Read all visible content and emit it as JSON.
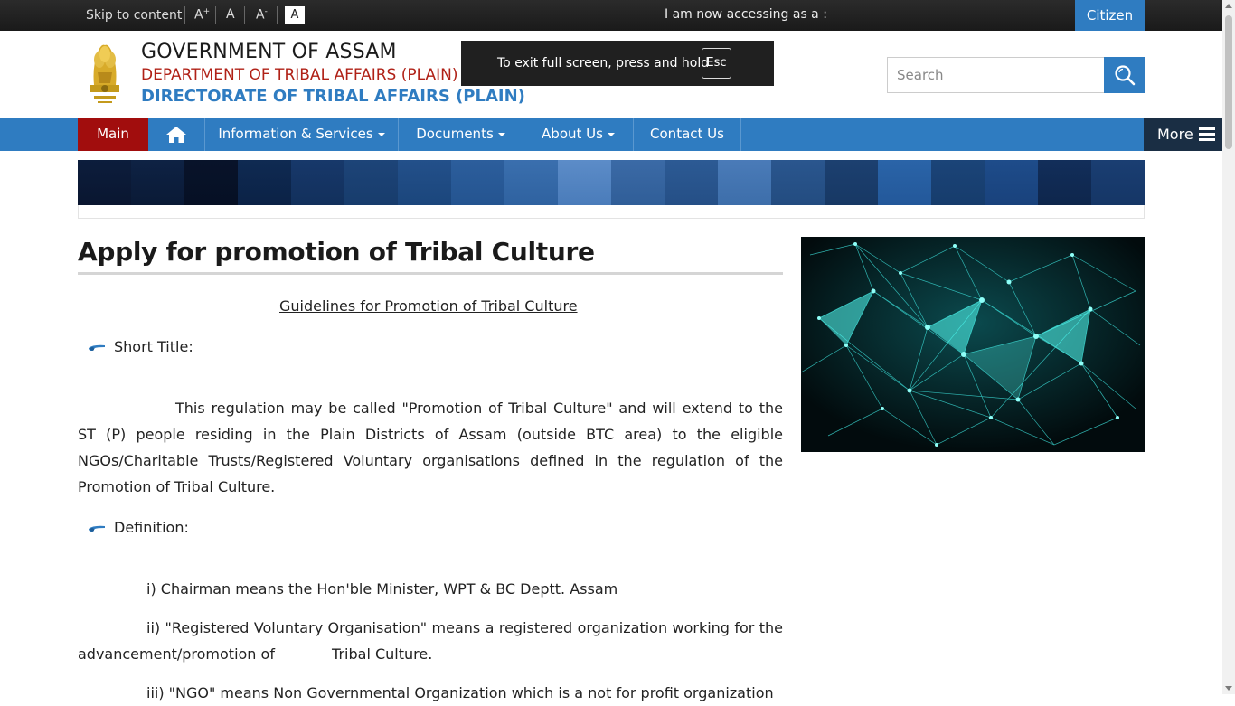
{
  "topbar": {
    "skip": "Skip to content",
    "font_increase": "A",
    "font_increase_sup": "+",
    "font_normal": "A",
    "font_decrease": "A",
    "font_decrease_sup": "-",
    "contrast": "A",
    "accessing": "I am now accessing as a :",
    "role": "Citizen"
  },
  "header": {
    "line1": "GOVERNMENT OF ASSAM",
    "line2": "DEPARTMENT OF TRIBAL AFFAIRS (PLAIN)",
    "line3": "DIRECTORATE OF TRIBAL AFFAIRS (PLAIN)"
  },
  "fullscreen": {
    "message": "To exit full screen, press and hold",
    "key": "Esc"
  },
  "search": {
    "placeholder": "Search"
  },
  "nav": {
    "main": "Main",
    "items": [
      "Information & Services",
      "Documents",
      "About Us",
      "Contact Us"
    ],
    "more": "More"
  },
  "content": {
    "title": "Apply for promotion of Tribal Culture",
    "guidelines": "Guidelines for Promotion of Tribal Culture",
    "short_title_label": "Short Title:",
    "short_title_text": "This regulation may be called \"Promotion of Tribal Culture\" and will extend to the ST (P) people residing in the Plain Districts of Assam (outside BTC area) to the eligible NGOs/Charitable Trusts/Registered Voluntary organisations defined in the regulation of the Promotion of Tribal Culture.",
    "definition_label": "Definition:",
    "def_i": "i) Chairman means the Hon'ble Minister, WPT & BC Deptt. Assam",
    "def_ii_a": "ii) \"Registered Voluntary Organisation\" means a registered organization working for the advancement/promotion of",
    "def_ii_b": "Tribal Culture.",
    "def_iii": "iii) \"NGO\" means Non Governmental Organization which is a not for profit organization"
  },
  "colors": {
    "accent": "#2f7cc1",
    "main_tab": "#a10d0d",
    "more": "#1a2e44",
    "header_red": "#b02117"
  }
}
